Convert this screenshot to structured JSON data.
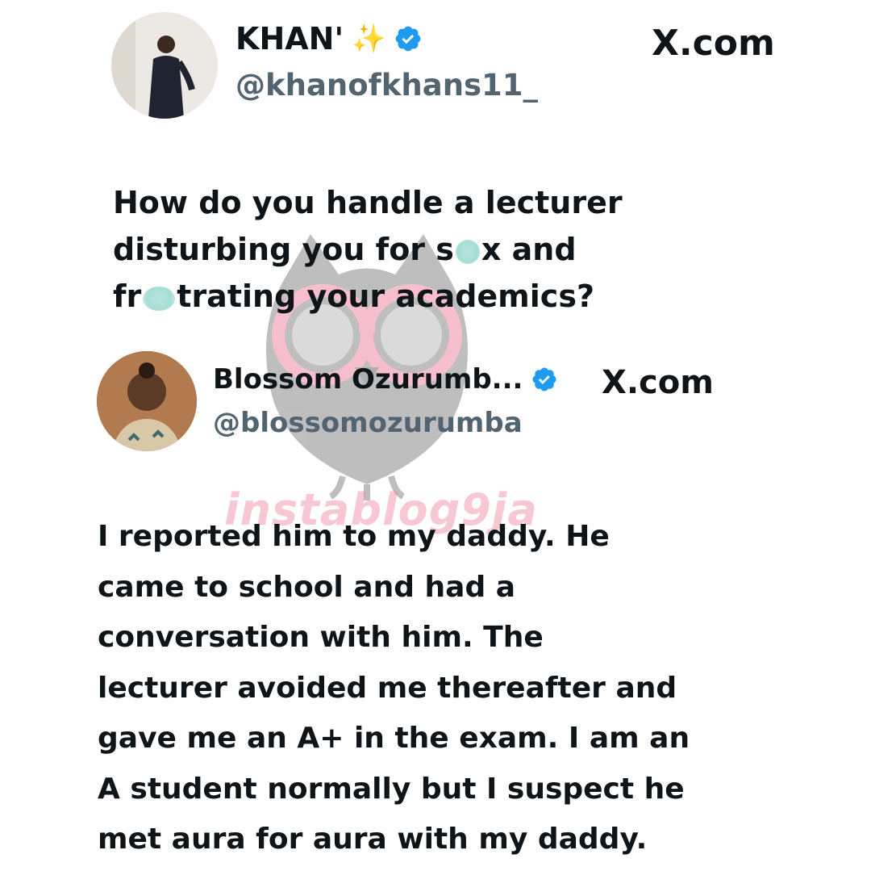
{
  "tweet1": {
    "name": "KHAN'",
    "name_emoji": "✨",
    "handle": "@khanofkhans11_",
    "site": "X.com",
    "text_lines": [
      "How do you handle a lecturer",
      "disturbing you for s",
      "x and",
      "fr",
      "trating your academics?"
    ]
  },
  "tweet2": {
    "name": "Blossom Ozurumb...",
    "handle": "@blossomozurumba",
    "site": "X.com",
    "text_lines": [
      "I reported him to my daddy. He",
      "came to school and had a",
      "conversation with him. The",
      "lecturer avoided me thereafter and",
      "gave me an A+ in the exam. I am an",
      "A student normally but I suspect he",
      "met aura for aura with my daddy."
    ]
  },
  "watermark": {
    "text": "instablog9ja"
  },
  "colors": {
    "text": "#0f1419",
    "handle": "#536471",
    "verified": "#1d9bf0",
    "watermark_pink": "#f0829f"
  },
  "icons": [
    "verified-badge-icon",
    "sparkles-icon",
    "x-logo-icon"
  ]
}
